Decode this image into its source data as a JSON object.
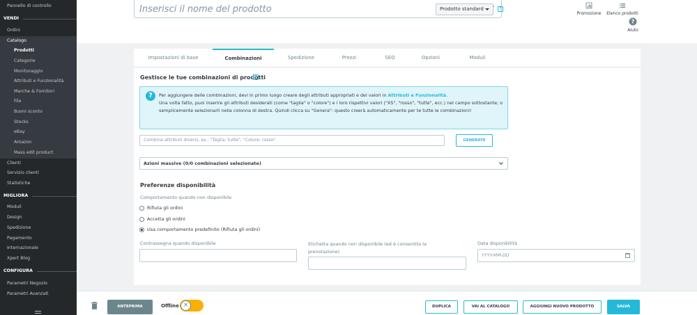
{
  "sidebar": {
    "top_item": "Pannello di controllo",
    "sections": [
      {
        "title": "VENDI"
      },
      {
        "title": "MIGLIORA"
      },
      {
        "title": "CONFIGURA"
      }
    ],
    "vendi_items": [
      "Ordini",
      "Catalogo"
    ],
    "catalog_sub": [
      "Prodotti",
      "Categorie",
      "Monitoraggio",
      "Attributi e Funzionalità",
      "Marche & Fornitori",
      "File",
      "Buoni sconto",
      "Stocks",
      "eBay",
      "Amazon",
      "Mass edit product"
    ],
    "vendi_after": [
      "Clienti",
      "Servizio clienti",
      "Statistiche"
    ],
    "migliora_items": [
      "Moduli",
      "Design",
      "Spedizione",
      "Pagamento",
      "Internazionale",
      "Xpert Blog"
    ],
    "configura_items": [
      "Parametri Negozio",
      "Parametri Avanzati"
    ]
  },
  "header": {
    "name_placeholder": "Inserisci il nome del prodotto",
    "product_type": "Prodotto standard",
    "links": [
      {
        "label": "Promozione",
        "icon": "bar-chart-icon"
      },
      {
        "label": "Elenco prodotti",
        "icon": "list-icon"
      },
      {
        "label": "Aiuto",
        "icon": "help-circle-icon"
      }
    ]
  },
  "tabs": [
    "Impostazioni di base",
    "Combinazioni",
    "Spedizione",
    "Prezzi",
    "SEO",
    "Opzioni",
    "Moduli"
  ],
  "combinations": {
    "title": "Gestisce le tue combinazioni di prodotti",
    "info_line1_pre": "Per aggiungere delle combinazioni, devi in primo luogo creare degli attributi appropriati e dei valori in ",
    "info_link": "Attributi e Funzionalità",
    "info_line1_post": ".",
    "info_rest": "Una volta fatto, puoi inserire gli attributi desiderati (come \"taglia\" o \"colore\") e i loro rispettivi valori (\"XS\", \"rosso\", \"tutte\", ecc.) nel campo sottostante; o semplicemente selezionarli nella colonna di destra. Quindi clicca su \"Genera\": questo creerà automaticamente per te tutte le combinazioni!",
    "combine_placeholder": "Combina attributi diversi, es.: \"Taglia: tutte\", \"Colore: rosso\".",
    "generate_label": "GENERATE",
    "bulk_label": "Azioni massive (0/0 combinazioni selezionate)"
  },
  "availability": {
    "title": "Preferenze disponibilità",
    "behavior_label": "Comportamento quando non disponibile",
    "options": [
      "Rifiuta gli ordini",
      "Accetta gli ordini",
      "Usa comportamento predefinito (Rifiuta gli ordini)"
    ],
    "selected_index": 2,
    "label_in_stock": "Contrassegna quando disponibile",
    "label_out_stock": "Etichetta quando non disponibile (ed è consentita la prenotazione)",
    "label_date": "Data disponibilità",
    "date_placeholder": "YYYY-MM-DD"
  },
  "footer": {
    "preview": "ANTEPRIMA",
    "offline": "Offline",
    "duplicate": "DUPLICA",
    "catalog": "VAI AL CATALOGO",
    "new_product": "AGGIUNGI NUOVO PRODOTTO",
    "save": "SALVA"
  }
}
